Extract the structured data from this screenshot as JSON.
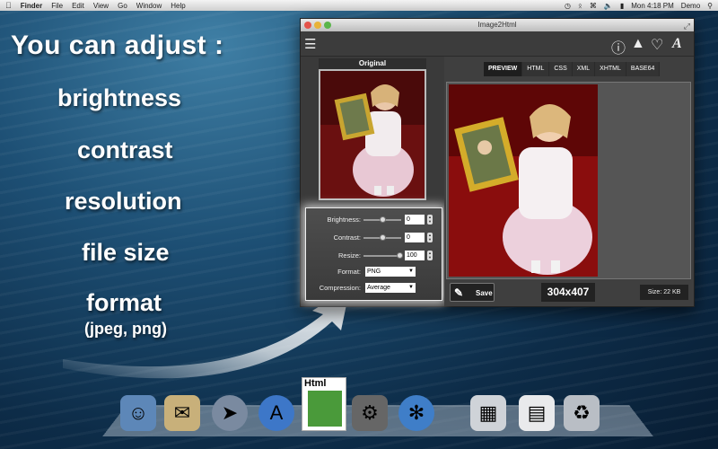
{
  "menubar": {
    "app_name": "Finder",
    "items": [
      "File",
      "Edit",
      "View",
      "Go",
      "Window",
      "Help"
    ],
    "clock": "Mon 4:18 PM",
    "user": "Demo"
  },
  "promo": {
    "heading": "You can adjust :",
    "items": [
      "brightness",
      "contrast",
      "resolution",
      "file size",
      "format"
    ],
    "format_detail": "(jpeg, png)"
  },
  "window": {
    "title": "Image2Html",
    "original_label": "Original",
    "tabs": [
      "PREVIEW",
      "HTML",
      "CSS",
      "XML",
      "XHTML",
      "BASE64"
    ],
    "active_tab": "PREVIEW",
    "controls": {
      "brightness": {
        "label": "Brightness:",
        "value": "0"
      },
      "contrast": {
        "label": "Contrast:",
        "value": "0"
      },
      "resize": {
        "label": "Resize:",
        "value": "100"
      },
      "format": {
        "label": "Format:",
        "value": "PNG"
      },
      "compression": {
        "label": "Compression:",
        "value": "Average"
      }
    },
    "save_label": "Save",
    "dimensions": "304x407",
    "size": "Size: 22 KB"
  },
  "dock_icon_label": "Html",
  "colors": {
    "accent_green": "#3aa53a",
    "window_bg": "#4a4a4a"
  }
}
